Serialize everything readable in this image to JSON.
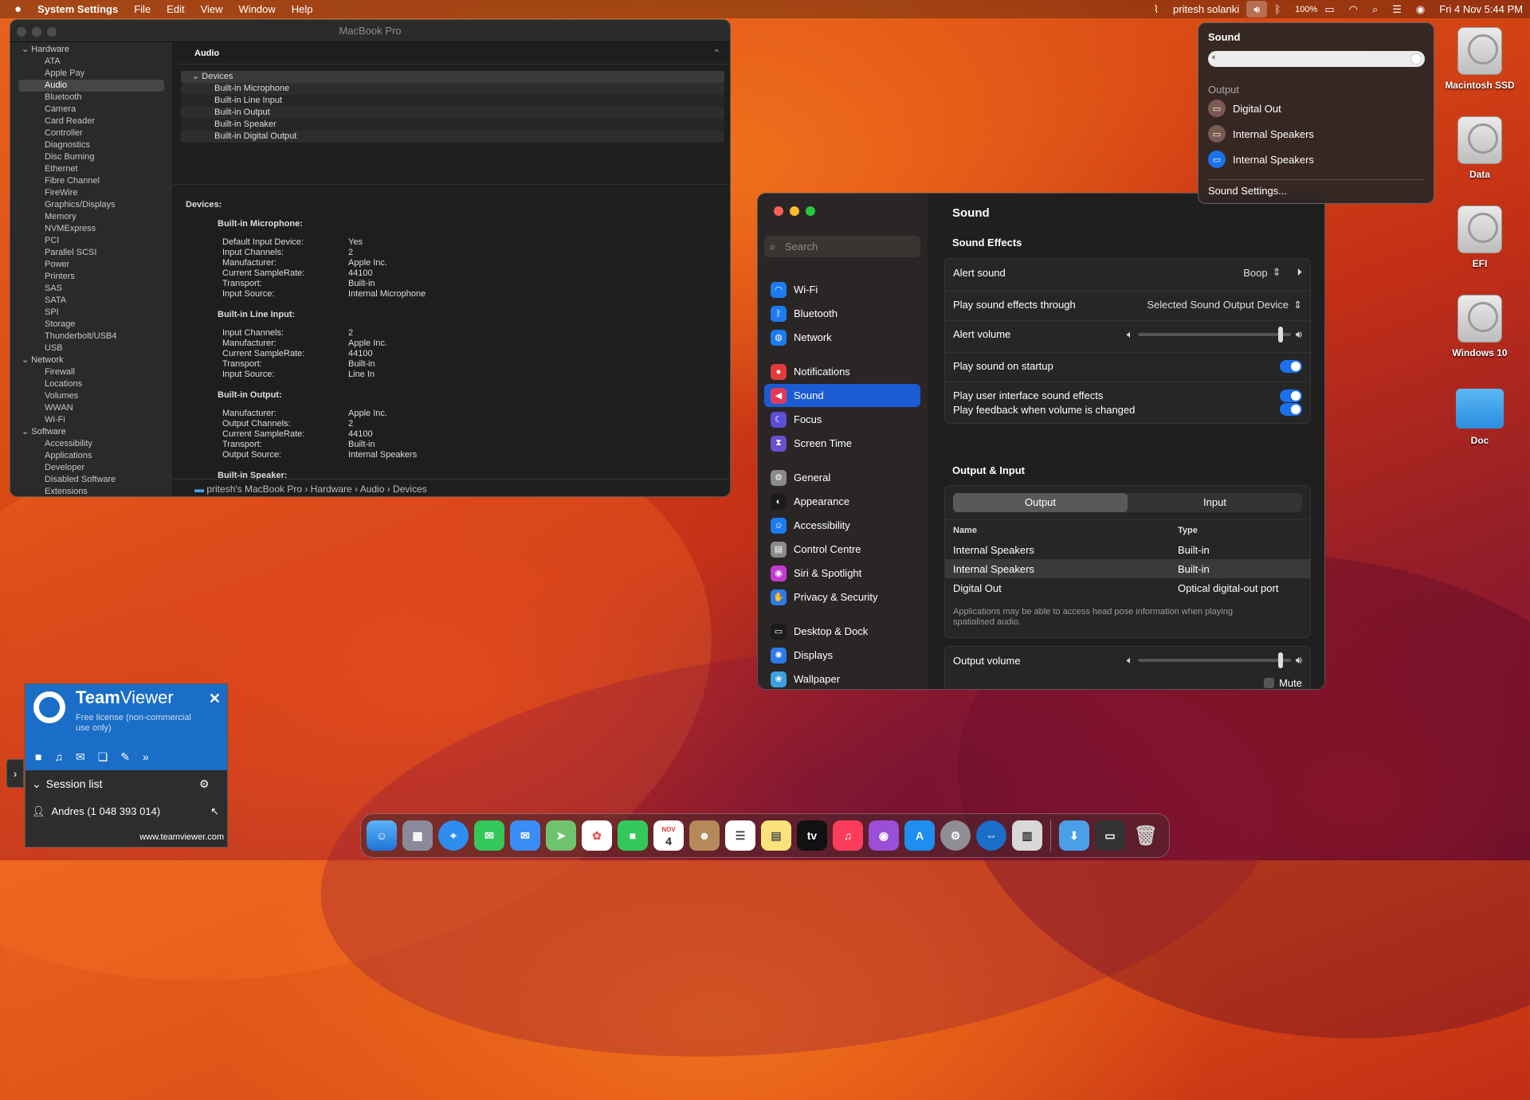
{
  "menubar": {
    "app_name": "System Settings",
    "menus": [
      "File",
      "Edit",
      "View",
      "Window",
      "Help"
    ],
    "user": "pritesh solanki",
    "battery": "100%",
    "datetime": "Fri 4 Nov  5:44 PM"
  },
  "sysinfo": {
    "window_title": "MacBook Pro",
    "sidebar": [
      {
        "type": "cat",
        "label": "Hardware"
      },
      {
        "type": "item",
        "label": "ATA"
      },
      {
        "type": "item",
        "label": "Apple Pay"
      },
      {
        "type": "item",
        "label": "Audio",
        "selected": true
      },
      {
        "type": "item",
        "label": "Bluetooth"
      },
      {
        "type": "item",
        "label": "Camera"
      },
      {
        "type": "item",
        "label": "Card Reader"
      },
      {
        "type": "item",
        "label": "Controller"
      },
      {
        "type": "item",
        "label": "Diagnostics"
      },
      {
        "type": "item",
        "label": "Disc Burning"
      },
      {
        "type": "item",
        "label": "Ethernet"
      },
      {
        "type": "item",
        "label": "Fibre Channel"
      },
      {
        "type": "item",
        "label": "FireWire"
      },
      {
        "type": "item",
        "label": "Graphics/Displays"
      },
      {
        "type": "item",
        "label": "Memory"
      },
      {
        "type": "item",
        "label": "NVMExpress"
      },
      {
        "type": "item",
        "label": "PCI"
      },
      {
        "type": "item",
        "label": "Parallel SCSI"
      },
      {
        "type": "item",
        "label": "Power"
      },
      {
        "type": "item",
        "label": "Printers"
      },
      {
        "type": "item",
        "label": "SAS"
      },
      {
        "type": "item",
        "label": "SATA"
      },
      {
        "type": "item",
        "label": "SPI"
      },
      {
        "type": "item",
        "label": "Storage"
      },
      {
        "type": "item",
        "label": "Thunderbolt/USB4"
      },
      {
        "type": "item",
        "label": "USB"
      },
      {
        "type": "cat",
        "label": "Network"
      },
      {
        "type": "item",
        "label": "Firewall"
      },
      {
        "type": "item",
        "label": "Locations"
      },
      {
        "type": "item",
        "label": "Volumes"
      },
      {
        "type": "item",
        "label": "WWAN"
      },
      {
        "type": "item",
        "label": "Wi-Fi"
      },
      {
        "type": "cat",
        "label": "Software"
      },
      {
        "type": "item",
        "label": "Accessibility"
      },
      {
        "type": "item",
        "label": "Applications"
      },
      {
        "type": "item",
        "label": "Developer"
      },
      {
        "type": "item",
        "label": "Disabled Software"
      },
      {
        "type": "item",
        "label": "Extensions"
      }
    ],
    "header": "Audio",
    "tree": [
      "Devices",
      "Built-in Microphone",
      "Built-in Line Input",
      "Built-in Output",
      "Built-in Speaker",
      "Built-in Digital Output"
    ],
    "details_heading": "Devices:",
    "devices": [
      {
        "name": "Built-in Microphone:",
        "props": [
          [
            "Default Input Device:",
            "Yes"
          ],
          [
            "Input Channels:",
            "2"
          ],
          [
            "Manufacturer:",
            "Apple Inc."
          ],
          [
            "Current SampleRate:",
            "44100"
          ],
          [
            "Transport:",
            "Built-in"
          ],
          [
            "Input Source:",
            "Internal Microphone"
          ]
        ]
      },
      {
        "name": "Built-in Line Input:",
        "props": [
          [
            "Input Channels:",
            "2"
          ],
          [
            "Manufacturer:",
            "Apple Inc."
          ],
          [
            "Current SampleRate:",
            "44100"
          ],
          [
            "Transport:",
            "Built-in"
          ],
          [
            "Input Source:",
            "Line In"
          ]
        ]
      },
      {
        "name": "Built-in Output:",
        "props": [
          [
            "Manufacturer:",
            "Apple Inc."
          ],
          [
            "Output Channels:",
            "2"
          ],
          [
            "Current SampleRate:",
            "44100"
          ],
          [
            "Transport:",
            "Built-in"
          ],
          [
            "Output Source:",
            "Internal Speakers"
          ]
        ]
      },
      {
        "name": "Built-in Speaker:",
        "props": []
      }
    ],
    "path": [
      "pritesh's MacBook Pro",
      "Hardware",
      "Audio",
      "Devices"
    ]
  },
  "sound_menu": {
    "title": "Sound",
    "output_label": "Output",
    "outputs": [
      {
        "label": "Digital Out",
        "active": false
      },
      {
        "label": "Internal Speakers",
        "active": false
      },
      {
        "label": "Internal Speakers",
        "active": true
      }
    ],
    "settings_link": "Sound Settings..."
  },
  "desktop_icons": [
    "Macintosh SSD",
    "Data",
    "EFI",
    "Windows 10",
    "Doc"
  ],
  "settings": {
    "search_placeholder": "Search",
    "nav": [
      {
        "label": "Wi-Fi",
        "color": "#1b7bf0",
        "glyph": "◠"
      },
      {
        "label": "Bluetooth",
        "color": "#1b7bf0",
        "glyph": "ᛒ"
      },
      {
        "label": "Network",
        "color": "#1b7bf0",
        "glyph": "◍"
      },
      {
        "label": "Notifications",
        "color": "#e23b3b",
        "glyph": "●",
        "gap": true
      },
      {
        "label": "Sound",
        "color": "#e23b5a",
        "glyph": "◀",
        "selected": true
      },
      {
        "label": "Focus",
        "color": "#5b4fd6",
        "glyph": "☾"
      },
      {
        "label": "Screen Time",
        "color": "#6a4fd0",
        "glyph": "⧗"
      },
      {
        "label": "General",
        "color": "#8a8a8a",
        "glyph": "⚙",
        "gap": true
      },
      {
        "label": "Appearance",
        "color": "#1c1c1c",
        "glyph": "◐"
      },
      {
        "label": "Accessibility",
        "color": "#1b7bf0",
        "glyph": "☺"
      },
      {
        "label": "Control Centre",
        "color": "#8a8a8a",
        "glyph": "▤"
      },
      {
        "label": "Siri & Spotlight",
        "color": "#c43ad0",
        "glyph": "◉"
      },
      {
        "label": "Privacy & Security",
        "color": "#2f7ae8",
        "glyph": "✋"
      },
      {
        "label": "Desktop & Dock",
        "color": "#1c1c1c",
        "glyph": "▭",
        "gap": true
      },
      {
        "label": "Displays",
        "color": "#2f7ae8",
        "glyph": "✺"
      },
      {
        "label": "Wallpaper",
        "color": "#3aa0e0",
        "glyph": "❀"
      }
    ],
    "page_title": "Sound",
    "effects_heading": "Sound Effects",
    "alert_sound_label": "Alert sound",
    "alert_sound_value": "Boop",
    "play_through_label": "Play sound effects through",
    "play_through_value": "Selected Sound Output Device",
    "alert_volume_label": "Alert volume",
    "alert_volume": 0.95,
    "startup_label": "Play sound on startup",
    "ui_effects_label": "Play user interface sound effects",
    "feedback_label": "Play feedback when volume is changed",
    "output_input_heading": "Output & Input",
    "tab_output": "Output",
    "tab_input": "Input",
    "col_name": "Name",
    "col_type": "Type",
    "devices": [
      {
        "name": "Internal Speakers",
        "type": "Built-in",
        "selected": false
      },
      {
        "name": "Internal Speakers",
        "type": "Built-in",
        "selected": true
      },
      {
        "name": "Digital Out",
        "type": "Optical digital-out port",
        "selected": false
      }
    ],
    "note": "Applications may be able to access head pose information when playing spatialised audio.",
    "output_volume_label": "Output volume",
    "output_volume": 0.95,
    "mute_label": "Mute"
  },
  "teamviewer": {
    "brand_team": "Team",
    "brand_viewer": "Viewer",
    "license": "Free license (non-commercial use only)",
    "session_list": "Session list",
    "contact": "Andres (1 048 393 014)",
    "url": "www.teamviewer.com"
  },
  "dock": {
    "calendar_month": "NOV",
    "calendar_day": "4",
    "tv_label": "tv"
  }
}
